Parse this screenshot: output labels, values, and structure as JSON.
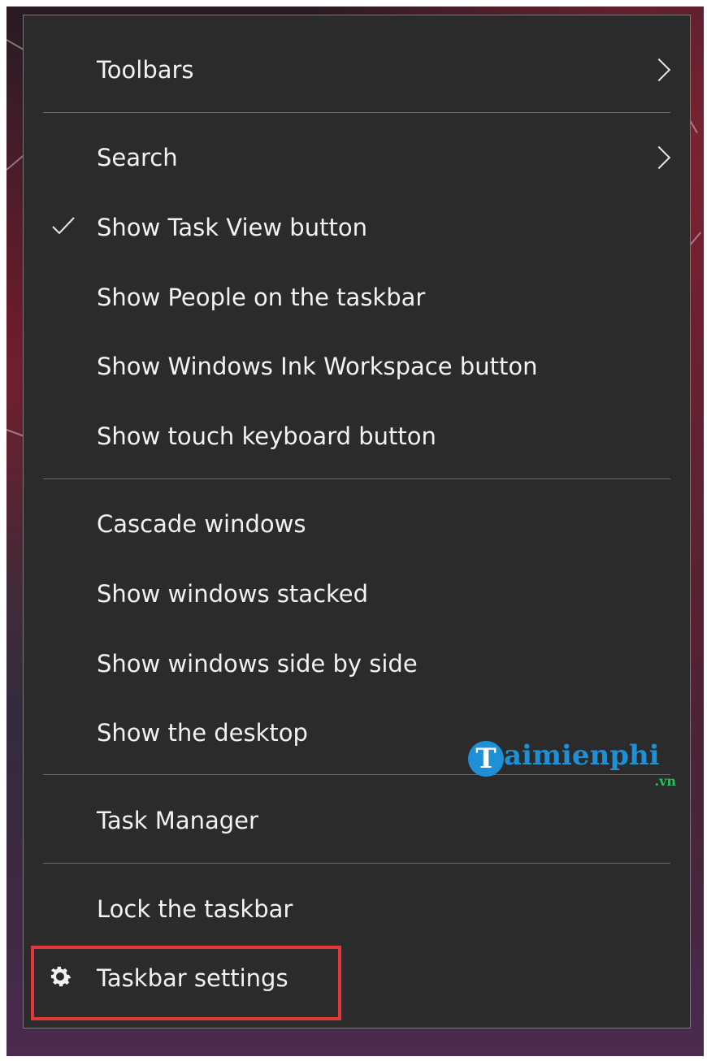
{
  "menu": {
    "items": [
      {
        "label": "Toolbars",
        "submenu": true
      },
      {
        "label": "Search",
        "submenu": true
      },
      {
        "label": "Show Task View button",
        "checked": true
      },
      {
        "label": "Show People on the taskbar"
      },
      {
        "label": "Show Windows Ink Workspace button"
      },
      {
        "label": "Show touch keyboard button"
      },
      {
        "label": "Cascade windows"
      },
      {
        "label": "Show windows stacked"
      },
      {
        "label": "Show windows side by side"
      },
      {
        "label": "Show the desktop"
      },
      {
        "label": "Task Manager"
      },
      {
        "label": "Lock the taskbar"
      },
      {
        "label": "Taskbar settings",
        "icon": "gear-icon",
        "highlighted": true
      }
    ]
  },
  "watermark": {
    "name": "aimienphi",
    "initial": "T",
    "tld": ".vn"
  },
  "colors": {
    "menu_bg": "#2b2b2b",
    "highlight": "#e0393b",
    "watermark_blue": "#1f8fd6",
    "watermark_green": "#22c15a"
  }
}
